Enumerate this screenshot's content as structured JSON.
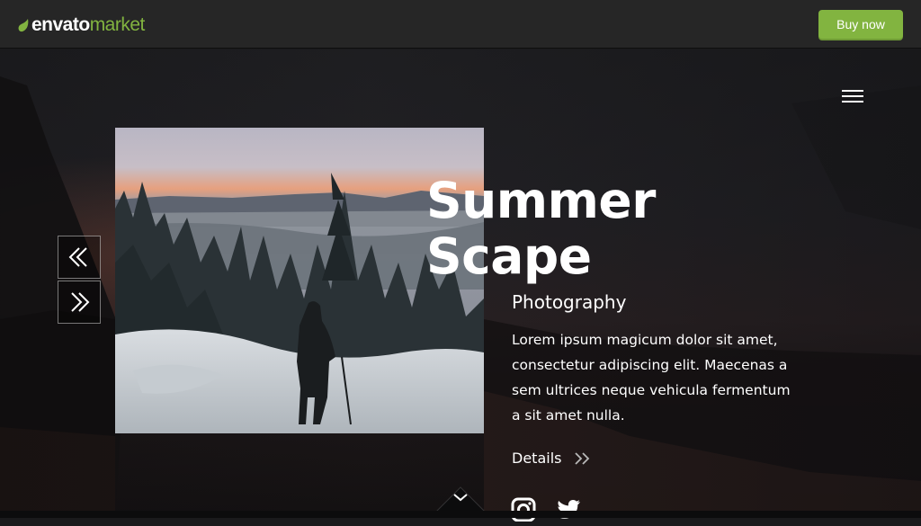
{
  "header": {
    "logo_brand": "envato",
    "logo_market": "market",
    "buy_label": "Buy now"
  },
  "slide": {
    "title_line1": "Summer",
    "title_line2": "Scape",
    "subtitle": "Photography",
    "description": "Lorem ipsum magicum dolor sit amet, consectetur adipiscing elit. Maecenas a sem ultrices neque vehicula fermentum a sit amet nulla.",
    "details_label": "Details"
  },
  "icons": {
    "logo": "leaf-icon",
    "menu": "hamburger-menu-icon",
    "prev": "double-chevron-left-icon",
    "next": "double-chevron-right-icon",
    "details": "double-chevron-right-icon",
    "social": [
      "instagram-icon",
      "twitter-icon"
    ],
    "scroll": "chevron-down-icon"
  },
  "colors": {
    "accent": "#82b440",
    "topbar": "#262626",
    "text": "#ffffff"
  }
}
